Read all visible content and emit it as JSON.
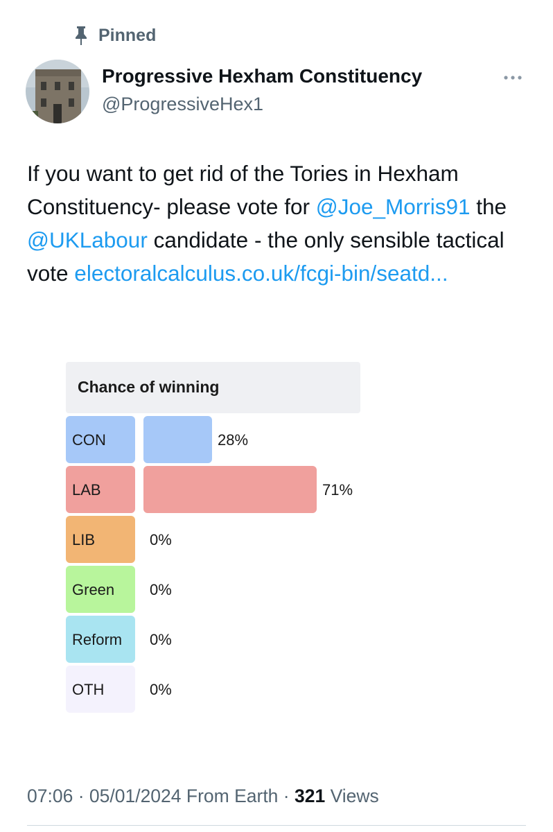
{
  "pinned_label": "Pinned",
  "author": {
    "display_name": "Progressive Hexham Constituency",
    "handle": "@ProgressiveHex1"
  },
  "tweet": {
    "seg1": "If you want to get rid of the Tories in Hexham Constituency- please vote for ",
    "mention1": "@Joe_Morris91",
    "seg2": " the ",
    "mention2": "@UKLabour",
    "seg3": " candidate - the only sensible tactical vote ",
    "link": "electoralcalculus.co.uk/fcgi-bin/seatd..."
  },
  "chart_data": {
    "type": "bar",
    "title": "Chance of winning",
    "categories": [
      "CON",
      "LAB",
      "LIB",
      "Green",
      "Reform",
      "OTH"
    ],
    "values": [
      28,
      71,
      0,
      0,
      0,
      0
    ],
    "value_labels": [
      "28%",
      "71%",
      "0%",
      "0%",
      "0%",
      "0%"
    ],
    "label_colors": [
      "#a6c8f8",
      "#f0a09d",
      "#f2b574",
      "#b8f59c",
      "#a9e4f1",
      "#f4f2fd"
    ],
    "bar_colors": [
      "#a6c8f8",
      "#f0a09d",
      "#f2b574",
      "#b8f59c",
      "#a9e4f1",
      "#f4f2fd"
    ],
    "xlim": [
      0,
      100
    ],
    "orientation": "horizontal"
  },
  "footer": {
    "time": "07:06",
    "sep1": " · ",
    "date": "05/01/2024",
    "source": " From Earth",
    "sep2": " · ",
    "views_count": "321",
    "views_label": " Views"
  },
  "icons": {
    "pin": "pin-icon",
    "more": "more-icon"
  }
}
